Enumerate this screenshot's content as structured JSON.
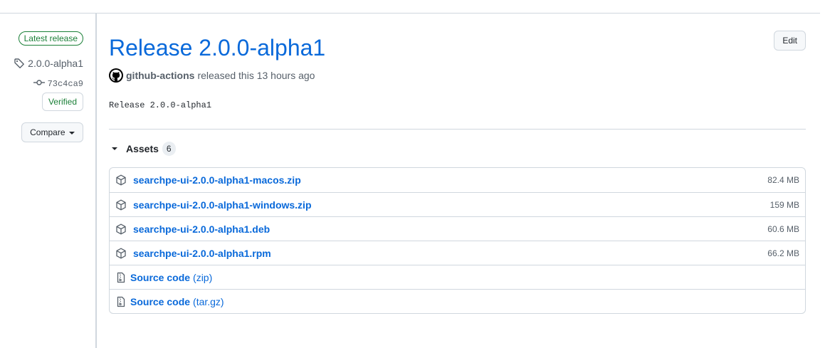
{
  "sidebar": {
    "latest_badge": "Latest release",
    "tag": "2.0.0-alpha1",
    "commit": "73c4ca9",
    "verified": "Verified",
    "compare_label": "Compare"
  },
  "release": {
    "title": "Release 2.0.0-alpha1",
    "edit_label": "Edit",
    "author": "github-actions",
    "released_text": "released this 13 hours ago",
    "notes": "Release 2.0.0-alpha1"
  },
  "assets": {
    "label": "Assets",
    "count": "6",
    "files": [
      {
        "name": "searchpe-ui-2.0.0-alpha1-macos.zip",
        "size": "82.4 MB"
      },
      {
        "name": "searchpe-ui-2.0.0-alpha1-windows.zip",
        "size": "159 MB"
      },
      {
        "name": "searchpe-ui-2.0.0-alpha1.deb",
        "size": "60.6 MB"
      },
      {
        "name": "searchpe-ui-2.0.0-alpha1.rpm",
        "size": "66.2 MB"
      }
    ],
    "source": [
      {
        "name": "Source code",
        "suffix": "(zip)"
      },
      {
        "name": "Source code",
        "suffix": "(tar.gz)"
      }
    ]
  },
  "colors": {
    "link": "#0969da",
    "success": "#1a7f37",
    "border": "#d0d7de",
    "muted": "#57606a"
  },
  "icons": {
    "tag": "tag-icon",
    "commit": "git-commit-icon",
    "package": "package-icon",
    "source": "file-zip-icon",
    "avatar": "github-mark-icon"
  }
}
